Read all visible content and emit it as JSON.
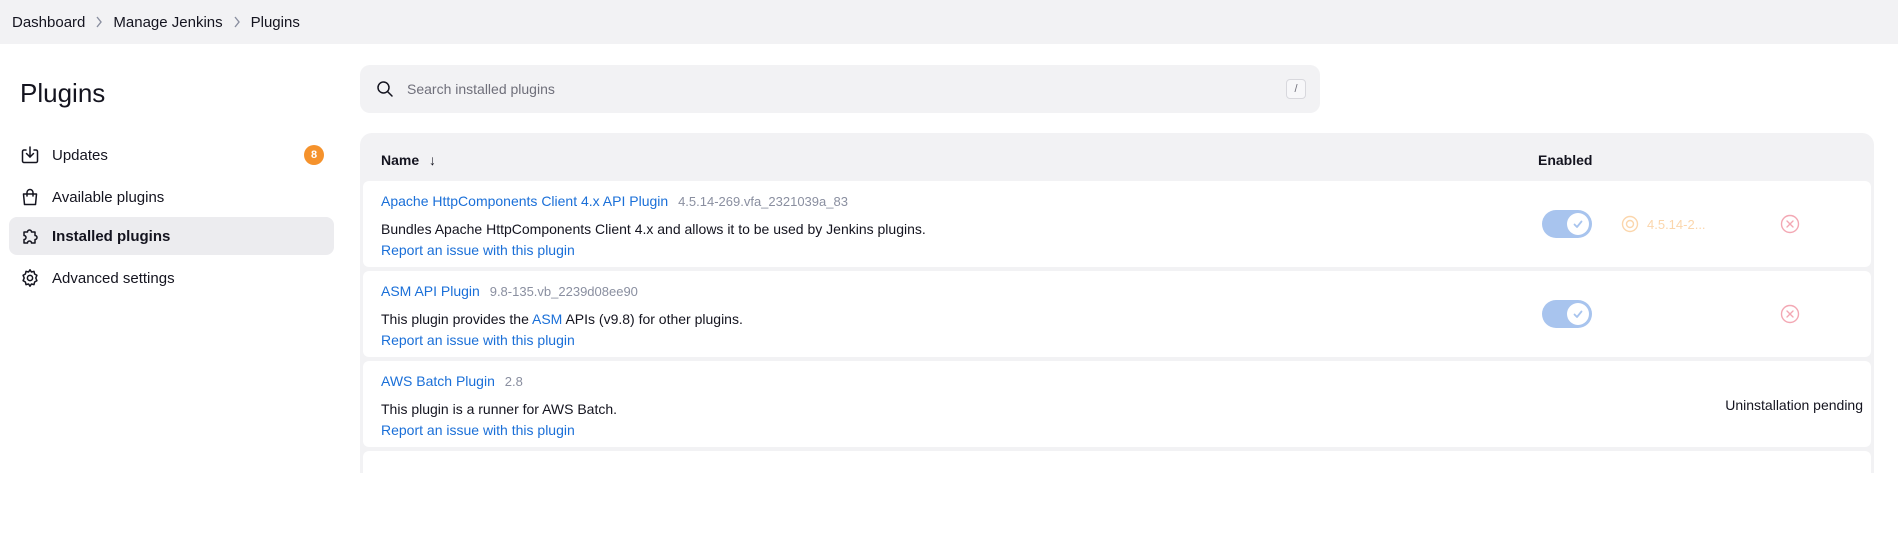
{
  "breadcrumb": {
    "items": [
      "Dashboard",
      "Manage Jenkins",
      "Plugins"
    ]
  },
  "sidebar": {
    "title": "Plugins",
    "items": [
      {
        "label": "Updates",
        "icon": "download-icon",
        "badge": "8"
      },
      {
        "label": "Available plugins",
        "icon": "shopping-bag-icon"
      },
      {
        "label": "Installed plugins",
        "icon": "puzzle-icon",
        "active": true
      },
      {
        "label": "Advanced settings",
        "icon": "gear-icon"
      }
    ]
  },
  "search": {
    "placeholder": "Search installed plugins",
    "value": "",
    "shortcut": "/"
  },
  "table": {
    "columns": {
      "name": "Name",
      "sort_indicator": "↓",
      "enabled": "Enabled"
    },
    "rows": [
      {
        "name": "Apache HttpComponents Client 4.x API Plugin",
        "version": "4.5.14-269.vfa_2321039a_83",
        "description": "Bundles Apache HttpComponents Client 4.x and allows it to be used by Jenkins plugins.",
        "report": "Report an issue with this plugin",
        "enabled": true,
        "downgrade": "4.5.14-2..."
      },
      {
        "name": "ASM API Plugin",
        "version": "9.8-135.vb_2239d08ee90",
        "description_pre": "This plugin provides the ",
        "description_link": "ASM",
        "description_post": " APIs (v9.8) for other plugins.",
        "report": "Report an issue with this plugin",
        "enabled": true
      },
      {
        "name": "AWS Batch Plugin",
        "version": "2.8",
        "description": "This plugin is a runner for AWS Batch.",
        "report": "Report an issue with this plugin",
        "status": "Uninstallation pending"
      }
    ]
  },
  "colors": {
    "accent_link": "#1a6fd8",
    "badge": "#f5922c",
    "toggle_on_disabled": "#a8c4ee",
    "uninstall_icon": "#f3a8b4"
  }
}
